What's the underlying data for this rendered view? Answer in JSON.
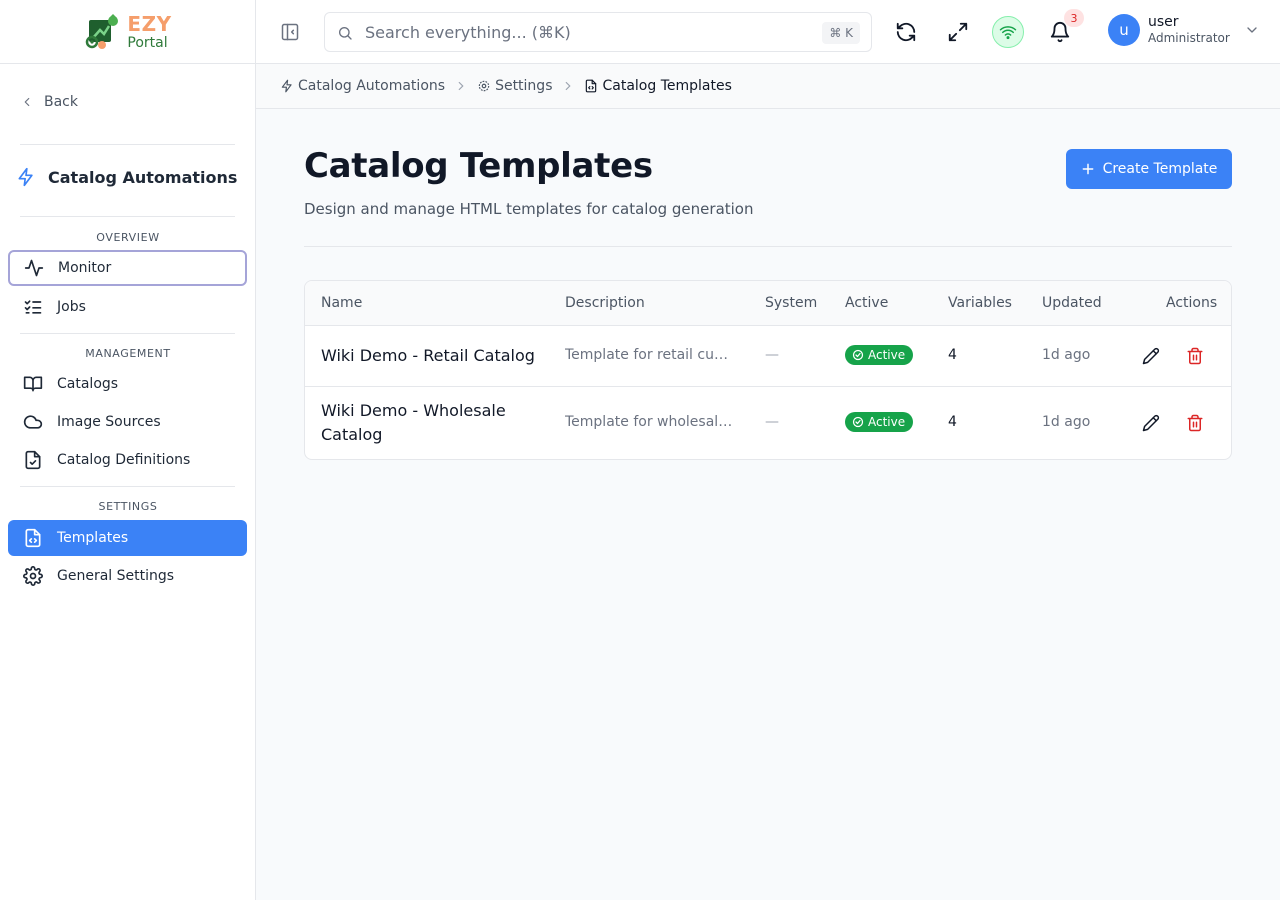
{
  "brand": {
    "line1": "EZY",
    "line2": "Portal"
  },
  "sidebar": {
    "back_label": "Back",
    "module_title": "Catalog Automations",
    "sections": [
      {
        "label": "OVERVIEW",
        "items": [
          {
            "label": "Monitor",
            "icon": "activity-icon"
          },
          {
            "label": "Jobs",
            "icon": "list-checks-icon"
          }
        ]
      },
      {
        "label": "MANAGEMENT",
        "items": [
          {
            "label": "Catalogs",
            "icon": "book-open-icon"
          },
          {
            "label": "Image Sources",
            "icon": "cloud-icon"
          },
          {
            "label": "Catalog Definitions",
            "icon": "file-check-icon"
          }
        ]
      },
      {
        "label": "SETTINGS",
        "items": [
          {
            "label": "Templates",
            "icon": "file-code-icon",
            "active": true
          },
          {
            "label": "General Settings",
            "icon": "gear-icon"
          }
        ]
      }
    ]
  },
  "topbar": {
    "search_placeholder": "Search everything... (⌘K)",
    "search_shortcut": "⌘ K",
    "notification_count": "3",
    "user": {
      "initial": "u",
      "name": "user",
      "role": "Administrator"
    }
  },
  "breadcrumb": [
    {
      "label": "Catalog Automations",
      "icon": "zap-icon"
    },
    {
      "label": "Settings",
      "icon": "gear-icon"
    },
    {
      "label": "Catalog Templates",
      "icon": "file-code-icon"
    }
  ],
  "page": {
    "title": "Catalog Templates",
    "subtitle": "Design and manage HTML templates for catalog generation",
    "create_label": "Create Template"
  },
  "table": {
    "columns": [
      "Name",
      "Description",
      "System",
      "Active",
      "Variables",
      "Updated",
      "Actions"
    ],
    "rows": [
      {
        "name": "Wiki Demo - Retail Catalog",
        "description": "Template for retail customers",
        "system": "—",
        "active": "Active",
        "variables": "4",
        "updated": "1d ago"
      },
      {
        "name": "Wiki Demo - Wholesale Catalog",
        "description": "Template for wholesale customers",
        "system": "—",
        "active": "Active",
        "variables": "4",
        "updated": "1d ago"
      }
    ]
  },
  "colors": {
    "accent": "#3b82f6",
    "success": "#16a34a",
    "danger": "#dc2626",
    "brand_orange": "#f59e6b",
    "brand_green": "#2f7a3a"
  }
}
